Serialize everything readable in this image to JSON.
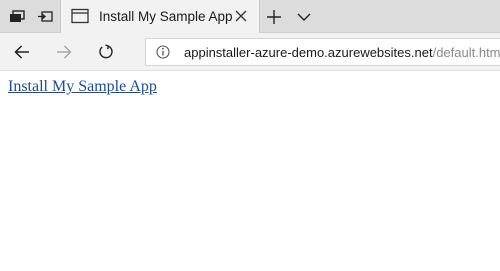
{
  "tab": {
    "title": "Install My Sample App"
  },
  "address": {
    "host": "appinstaller-azure-demo.azurewebsites.net",
    "path": "/default.html"
  },
  "page": {
    "link_text": "Install My Sample App"
  },
  "icons": {
    "tab_actions": "tab-actions-icon",
    "set_tabs_aside": "set-tabs-aside-icon",
    "tab_page": "page-icon",
    "close": "close-icon",
    "new_tab": "plus-icon",
    "tab_preview": "chevron-down-icon",
    "back": "back-arrow-icon",
    "forward": "forward-arrow-icon",
    "refresh": "refresh-icon",
    "site_info": "info-icon"
  },
  "colors": {
    "tab_bar": "#dcdcdc",
    "active_tab": "#f2f2f2",
    "link": "#1a4c9c",
    "url_path": "#8a8a8a"
  }
}
